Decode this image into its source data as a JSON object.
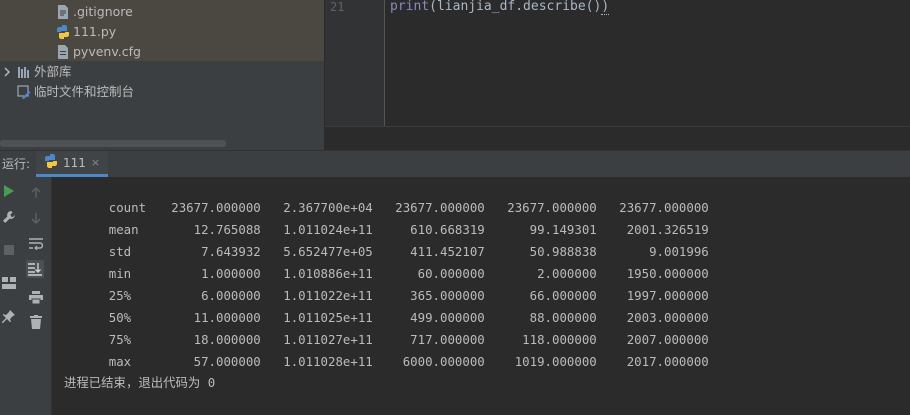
{
  "project_tree": {
    "items": [
      {
        "label": ".gitignore",
        "icon": "text-file-icon"
      },
      {
        "label": "111.py",
        "icon": "python-file-icon"
      },
      {
        "label": "pyvenv.cfg",
        "icon": "config-file-icon"
      },
      {
        "label": "外部库",
        "icon": "library-icon"
      },
      {
        "label": "临时文件和控制台",
        "icon": "scratches-icon"
      }
    ]
  },
  "editor": {
    "line_number": "21",
    "code_kw": "print",
    "code_rest": "(lianjia_df.describe()",
    "code_end": ")"
  },
  "run": {
    "title": "运行:",
    "tab_label": "111",
    "tab_close": "×"
  },
  "console": {
    "header_row": {
      "label": "count",
      "values": [
        "23677.000000",
        "2.367700e+04",
        "23677.000000",
        "23677.000000",
        "23677.000000"
      ]
    },
    "rows": [
      {
        "label": "mean",
        "values": [
          "12.765088",
          "1.011024e+11",
          "610.668319",
          "99.149301",
          "2001.326519"
        ]
      },
      {
        "label": "std",
        "values": [
          "7.643932",
          "5.652477e+05",
          "411.452107",
          "50.988838",
          "9.001996"
        ]
      },
      {
        "label": "min",
        "values": [
          "1.000000",
          "1.010886e+11",
          "60.000000",
          "2.000000",
          "1950.000000"
        ]
      },
      {
        "label": "25%",
        "values": [
          "6.000000",
          "1.011022e+11",
          "365.000000",
          "66.000000",
          "1997.000000"
        ]
      },
      {
        "label": "50%",
        "values": [
          "11.000000",
          "1.011025e+11",
          "499.000000",
          "88.000000",
          "2003.000000"
        ]
      },
      {
        "label": "75%",
        "values": [
          "18.000000",
          "1.011027e+11",
          "717.000000",
          "118.000000",
          "2007.000000"
        ]
      },
      {
        "label": "max",
        "values": [
          "57.000000",
          "1.011028e+11",
          "6000.000000",
          "1019.000000",
          "2017.000000"
        ]
      }
    ],
    "exit_message": "进程已结束，退出代码为 0"
  },
  "colors": {
    "background": "#2b2b2b",
    "panel": "#3c3f41",
    "text": "#bbbbbb",
    "run_green": "#499c54",
    "accent": "#4a88c7"
  }
}
